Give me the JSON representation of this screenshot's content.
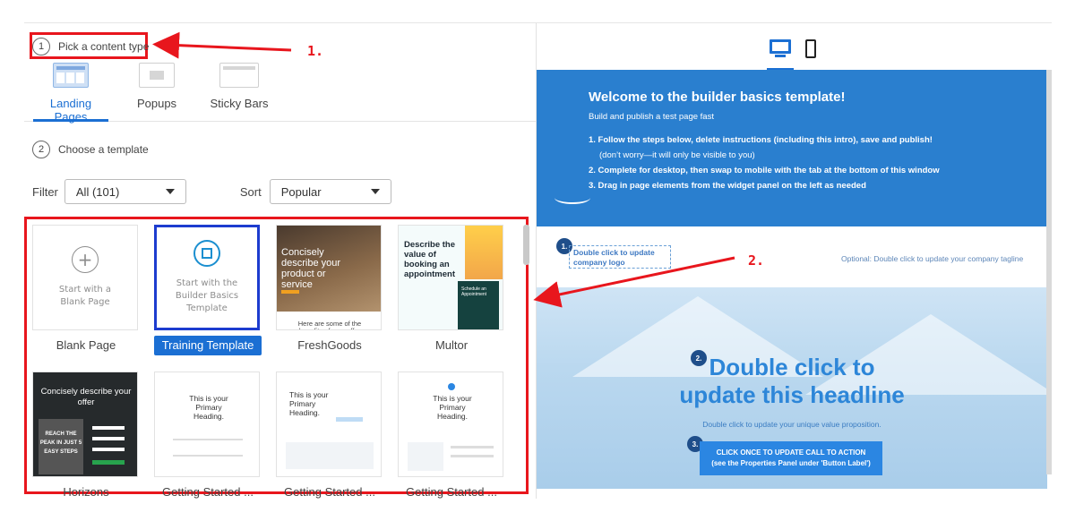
{
  "builder": {
    "step1": {
      "number": "1",
      "label": "Pick a content type"
    },
    "tabs": [
      {
        "label": "Landing Pages",
        "icon": "landing-page-icon",
        "active": true
      },
      {
        "label": "Popups",
        "icon": "popup-icon",
        "active": false
      },
      {
        "label": "Sticky Bars",
        "icon": "sticky-bar-icon",
        "active": false
      }
    ],
    "step2": {
      "number": "2",
      "label": "Choose a template"
    },
    "filter": {
      "label": "Filter",
      "value": "All (101)"
    },
    "sort": {
      "label": "Sort",
      "value": "Popular"
    },
    "templates": [
      {
        "name": "Blank Page",
        "thumb_text": "Start with a Blank Page",
        "icon": "plus-circle-icon",
        "selected": false
      },
      {
        "name": "Training Template",
        "thumb_text": "Start with the Builder Basics Template",
        "icon": "builder-icon",
        "selected": true
      },
      {
        "name": "FreshGoods",
        "thumb_text": "Concisely describe your product or service",
        "thumb_footer": "Here are some of the benefits of your offer",
        "selected": false
      },
      {
        "name": "Multor",
        "thumb_text": "Describe the value of booking an appointment",
        "thumb_side": "Schedule an Appointment",
        "selected": false
      },
      {
        "name": "Horizons",
        "thumb_text": "Concisely describe your offer",
        "thumb_inner": "REACH THE PEAK IN JUST 5 EASY STEPS",
        "selected": false
      },
      {
        "name": "Getting Started ...",
        "thumb_text": "This is your Primary Heading.",
        "selected": false
      },
      {
        "name": "Getting Started ...",
        "thumb_text": "This is your Primary Heading.",
        "selected": false
      },
      {
        "name": "Getting Started ...",
        "thumb_text": "This is your Primary Heading.",
        "selected": false
      }
    ]
  },
  "preview": {
    "devices": [
      {
        "name": "desktop-icon",
        "active": true
      },
      {
        "name": "mobile-icon",
        "active": false
      }
    ],
    "hero": {
      "title": "Welcome to the builder basics template!",
      "subtitle": "Build and publish a test page fast",
      "steps": [
        "1. Follow the steps below, delete instructions (including this intro), save and publish!",
        "(don’t worry—it will only be visible to you)",
        "2. Complete for desktop, then swap to mobile with the tab at the bottom of this window",
        "3. Drag in page elements from the widget panel on the left as needed"
      ]
    },
    "logo": {
      "badge": "1.",
      "text": "Double click to update company logo",
      "tagline": "Optional: Double click to update your company tagline"
    },
    "headline": {
      "badge": "2.",
      "text": "Double click to update this headline",
      "uvp": "Double click to update your unique value proposition."
    },
    "cta": {
      "badge": "3.",
      "text": "CLICK ONCE TO UPDATE CALL TO ACTION (see the Properties Panel under 'Button Label')"
    }
  },
  "annotations": {
    "a1": "1.",
    "a2": "2."
  },
  "colors": {
    "accent": "#1b6fd3",
    "annotation": "#e8161d",
    "hero": "#2a7fcf"
  }
}
